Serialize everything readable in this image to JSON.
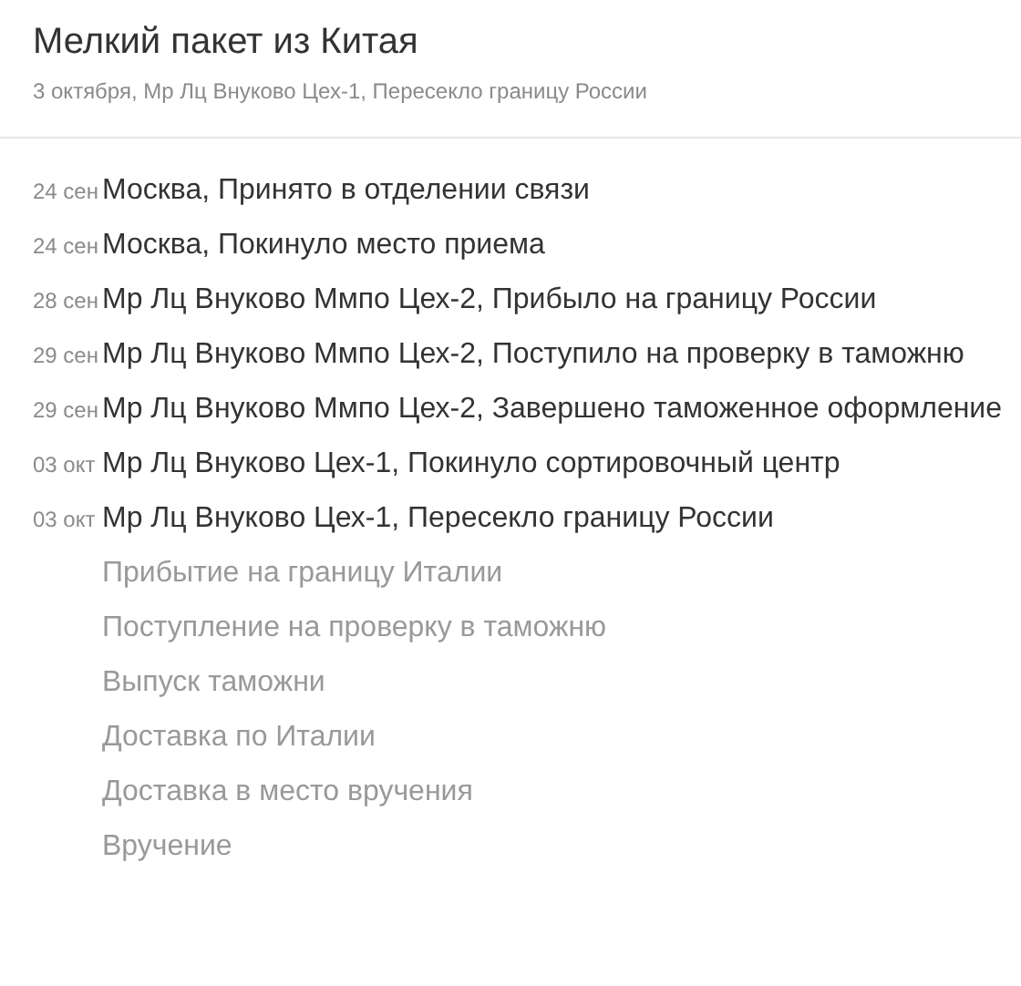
{
  "header": {
    "title": "Мелкий пакет из Китая",
    "subtitle": "3 октября, Мр Лц Внуково Цех-1, Пересекло границу России"
  },
  "events": [
    {
      "date": "24 сен",
      "text": "Москва, Принято в отделении связи",
      "done": true
    },
    {
      "date": "24 сен",
      "text": "Москва, Покинуло место приема",
      "done": true
    },
    {
      "date": "28 сен",
      "text": "Мр Лц Внуково Ммпо Цех-2, Прибыло на границу России",
      "done": true
    },
    {
      "date": "29 сен",
      "text": "Мр Лц Внуково Ммпо Цех-2, Поступило на проверку в таможню",
      "done": true
    },
    {
      "date": "29 сен",
      "text": "Мр Лц Внуково Ммпо Цех-2, Завершено таможенное оформление",
      "done": true
    },
    {
      "date": "03 окт",
      "text": "Мр Лц Внуково Цех-1, Покинуло сортировочный центр",
      "done": true
    },
    {
      "date": "03 окт",
      "text": "Мр Лц Внуково Цех-1, Пересекло границу России",
      "done": true
    },
    {
      "text": "Прибытие на границу Италии",
      "done": false
    },
    {
      "text": "Поступление на проверку в таможню",
      "done": false
    },
    {
      "text": "Выпуск таможни",
      "done": false
    },
    {
      "text": "Доставка по Италии",
      "done": false
    },
    {
      "text": "Доставка в место вручения",
      "done": false
    },
    {
      "text": "Вручение",
      "done": false
    }
  ]
}
